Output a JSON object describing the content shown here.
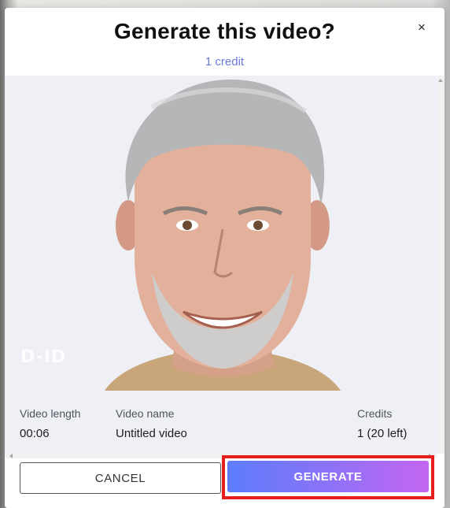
{
  "dialog": {
    "title": "Generate this video?",
    "subtitle": "1 credit",
    "close_label": "×"
  },
  "preview": {
    "image": "portrait of smiling grey-haired man",
    "watermark": "D-ID"
  },
  "info": {
    "video_length_label": "Video length",
    "video_length_value": "00:06",
    "video_name_label": "Video name",
    "video_name_value": "Untitled video",
    "credits_label": "Credits",
    "credits_value": "1 (20 left)"
  },
  "actions": {
    "cancel_label": "CANCEL",
    "generate_label": "GENERATE"
  },
  "colors": {
    "accent": "#6a7bd8",
    "generate_gradient_start": "#5d7dfc",
    "generate_gradient_end": "#c466f2",
    "highlight_frame": "#e81d1d"
  }
}
